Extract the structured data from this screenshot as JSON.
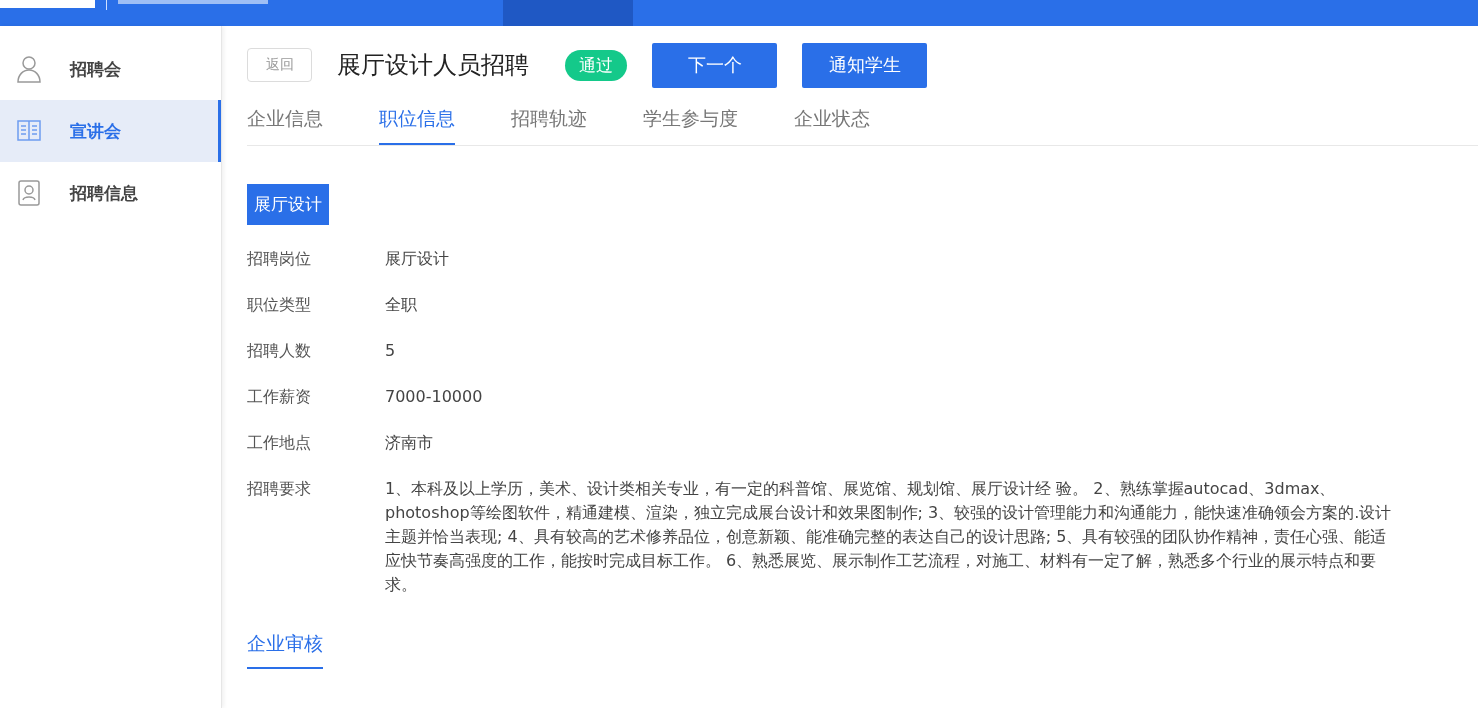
{
  "sidebar": {
    "items": [
      {
        "label": "招聘会",
        "kind": "person",
        "selected": false
      },
      {
        "label": "宣讲会",
        "kind": "book",
        "selected": true
      },
      {
        "label": "招聘信息",
        "kind": "badge",
        "selected": false
      }
    ]
  },
  "header": {
    "back": "返回",
    "title": "展厅设计人员招聘",
    "status": "通过",
    "buttons": [
      "下一个",
      "通知学生"
    ]
  },
  "tabs": [
    {
      "label": "企业信息",
      "selected": false
    },
    {
      "label": "职位信息",
      "selected": true
    },
    {
      "label": "招聘轨迹",
      "selected": false
    },
    {
      "label": "学生参与度",
      "selected": false
    },
    {
      "label": "企业状态",
      "selected": false
    }
  ],
  "position_tag": "展厅设计",
  "fields": [
    {
      "label": "招聘岗位",
      "value": "展厅设计"
    },
    {
      "label": "职位类型",
      "value": "全职"
    },
    {
      "label": "招聘人数",
      "value": "5"
    },
    {
      "label": "工作薪资",
      "value": "7000-10000"
    },
    {
      "label": "工作地点",
      "value": "济南市"
    },
    {
      "label": "招聘要求",
      "value": "1、本科及以上学历，美术、设计类相关专业，有一定的科普馆、展览馆、规划馆、展厅设计经 验。 2、熟练掌握autocad、3dmax、photoshop等绘图软件，精通建模、渲染，独立完成展台设计和效果图制作; 3、较强的设计管理能力和沟通能力，能快速准确领会方案的.设计主题并恰当表现; 4、具有较高的艺术修养品位，创意新颖、能准确完整的表达自己的设计思路; 5、具有较强的团队协作精神，责任心强、能适应快节奏高强度的工作，能按时完成目标工作。 6、熟悉展览、展示制作工艺流程，对施工、材料有一定了解，熟悉多个行业的展示特点和要求。"
    }
  ],
  "section": {
    "label": "企业审核",
    "selected": true
  }
}
